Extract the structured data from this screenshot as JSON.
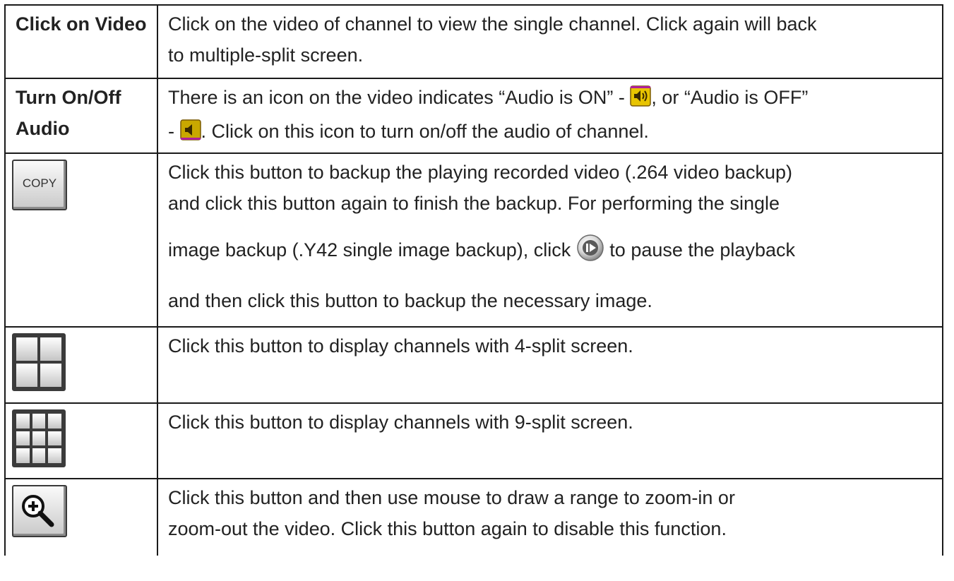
{
  "rows": [
    {
      "term": "Click on Video",
      "desc_lines": [
        "Click on the video of channel to view the single channel. Click again will back",
        "to multiple-split screen."
      ]
    },
    {
      "term": "Turn On/Off Audio",
      "desc_part1": "There is an icon on the video indicates “Audio is ON” - ",
      "desc_part2": ", or “Audio is OFF”",
      "desc_part3": "- ",
      "desc_part4": ". Click on this icon to turn on/off the audio of channel."
    },
    {
      "button_label": "COPY",
      "desc_line1": "Click this button to backup the playing recorded video (.264 video backup)",
      "desc_line2": "and click this button again to finish the backup. For performing the single",
      "desc_line3a": "image backup (.Y42 single image backup), click ",
      "desc_line3b": " to pause the playback",
      "desc_line4": "and then click this button to backup the necessary image."
    },
    {
      "desc": "Click this button to display channels with 4-split screen."
    },
    {
      "desc": "Click this button to display channels with 9-split screen."
    },
    {
      "desc_lines": [
        "Click this button and then use mouse to draw a range to zoom-in or",
        "zoom-out the video. Click this button again to disable this function."
      ]
    }
  ],
  "icons": {
    "audio_on": "speaker-on-icon",
    "audio_off": "speaker-off-icon",
    "pause_play": "play-pause-icon",
    "copy": "copy-button",
    "split4": "four-split-icon",
    "split9": "nine-split-icon",
    "zoom": "zoom-in-icon"
  },
  "colors": {
    "border": "#1a1a1a",
    "text": "#222222",
    "audio_icon_bg": "#e8c400"
  }
}
